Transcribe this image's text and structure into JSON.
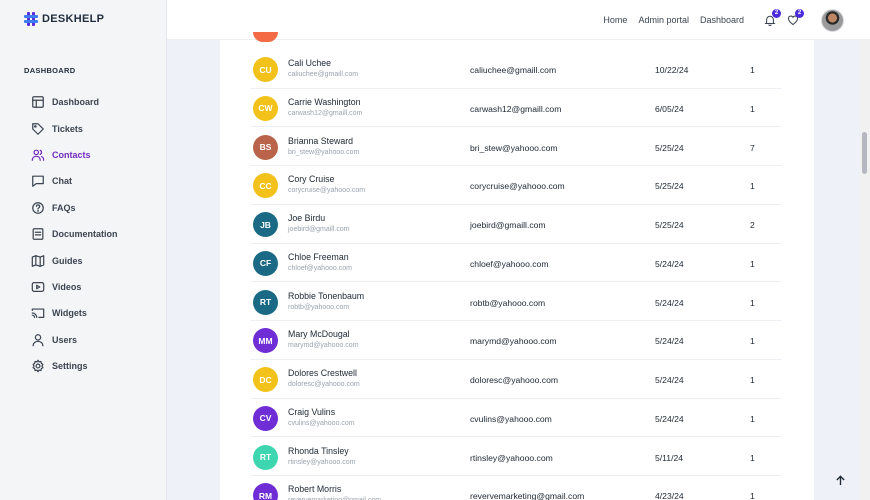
{
  "brand": {
    "name": "DESKHELP"
  },
  "sidebar": {
    "section_title": "DASHBOARD",
    "items": [
      {
        "label": "Dashboard",
        "icon": "layout-icon"
      },
      {
        "label": "Tickets",
        "icon": "tag-icon"
      },
      {
        "label": "Contacts",
        "icon": "users-icon",
        "active": true
      },
      {
        "label": "Chat",
        "icon": "chat-icon"
      },
      {
        "label": "FAQs",
        "icon": "help-circle-icon"
      },
      {
        "label": "Documentation",
        "icon": "document-icon"
      },
      {
        "label": "Guides",
        "icon": "map-icon"
      },
      {
        "label": "Videos",
        "icon": "video-icon"
      },
      {
        "label": "Widgets",
        "icon": "cast-icon"
      },
      {
        "label": "Users",
        "icon": "user-icon"
      },
      {
        "label": "Settings",
        "icon": "gear-icon"
      }
    ]
  },
  "header": {
    "links": [
      "Home",
      "Admin portal",
      "Dashboard"
    ],
    "notifications_badge": "2",
    "favorites_badge": "2"
  },
  "colors": {
    "accent": "#6f2dbd",
    "avatar_yellow": "#f2c21b",
    "avatar_brown": "#b9644a",
    "avatar_teal": "#1a6a85",
    "avatar_purple": "#6f2dd6",
    "avatar_mint": "#3dd6b0"
  },
  "contacts": [
    {
      "initials": "CU",
      "name": "Cali Uchee",
      "sub": "caliuchee@gmaill.com",
      "email": "caliuchee@gmaill.com",
      "date": "10/22/24",
      "count": "1",
      "color": "#f2c21b"
    },
    {
      "initials": "CW",
      "name": "Carrie Washington",
      "sub": "carwash12@gmaill.com",
      "email": "carwash12@gmaill.com",
      "date": "6/05/24",
      "count": "1",
      "color": "#f2c21b"
    },
    {
      "initials": "BS",
      "name": "Brianna Steward",
      "sub": "bri_stew@yahooo.com",
      "email": "bri_stew@yahooo.com",
      "date": "5/25/24",
      "count": "7",
      "color": "#b9644a"
    },
    {
      "initials": "CC",
      "name": "Cory Cruise",
      "sub": "corycruise@yahooo.com",
      "email": "corycruise@yahooo.com",
      "date": "5/25/24",
      "count": "1",
      "color": "#f2c21b"
    },
    {
      "initials": "JB",
      "name": "Joe Birdu",
      "sub": "joebird@gmaill.com",
      "email": "joebird@gmaill.com",
      "date": "5/25/24",
      "count": "2",
      "color": "#1a6a85"
    },
    {
      "initials": "CF",
      "name": "Chloe Freeman",
      "sub": "chloef@yahooo.com",
      "email": "chloef@yahooo.com",
      "date": "5/24/24",
      "count": "1",
      "color": "#1a6a85"
    },
    {
      "initials": "RT",
      "name": "Robbie Tonenbaum",
      "sub": "robtb@yahooo.com",
      "email": "robtb@yahooo.com",
      "date": "5/24/24",
      "count": "1",
      "color": "#1a6a85"
    },
    {
      "initials": "MM",
      "name": "Mary McDougal",
      "sub": "marymd@yahooo.com",
      "email": "marymd@yahooo.com",
      "date": "5/24/24",
      "count": "1",
      "color": "#6f2dd6"
    },
    {
      "initials": "DC",
      "name": "Dolores Crestwell",
      "sub": "doloresc@yahooo.com",
      "email": "doloresc@yahooo.com",
      "date": "5/24/24",
      "count": "1",
      "color": "#f2c21b"
    },
    {
      "initials": "CV",
      "name": "Craig Vulins",
      "sub": "cvulins@yahooo.com",
      "email": "cvulins@yahooo.com",
      "date": "5/24/24",
      "count": "1",
      "color": "#6f2dd6"
    },
    {
      "initials": "RT",
      "name": "Rhonda Tinsley",
      "sub": "rtinsley@yahooo.com",
      "email": "rtinsley@yahooo.com",
      "date": "5/11/24",
      "count": "1",
      "color": "#3dd6b0"
    },
    {
      "initials": "RM",
      "name": "Robert Morris",
      "sub": "revervemarketing@gmail.com",
      "email": "revervemarketing@gmail.com",
      "date": "4/23/24",
      "count": "1",
      "color": "#6f2dd6"
    }
  ]
}
